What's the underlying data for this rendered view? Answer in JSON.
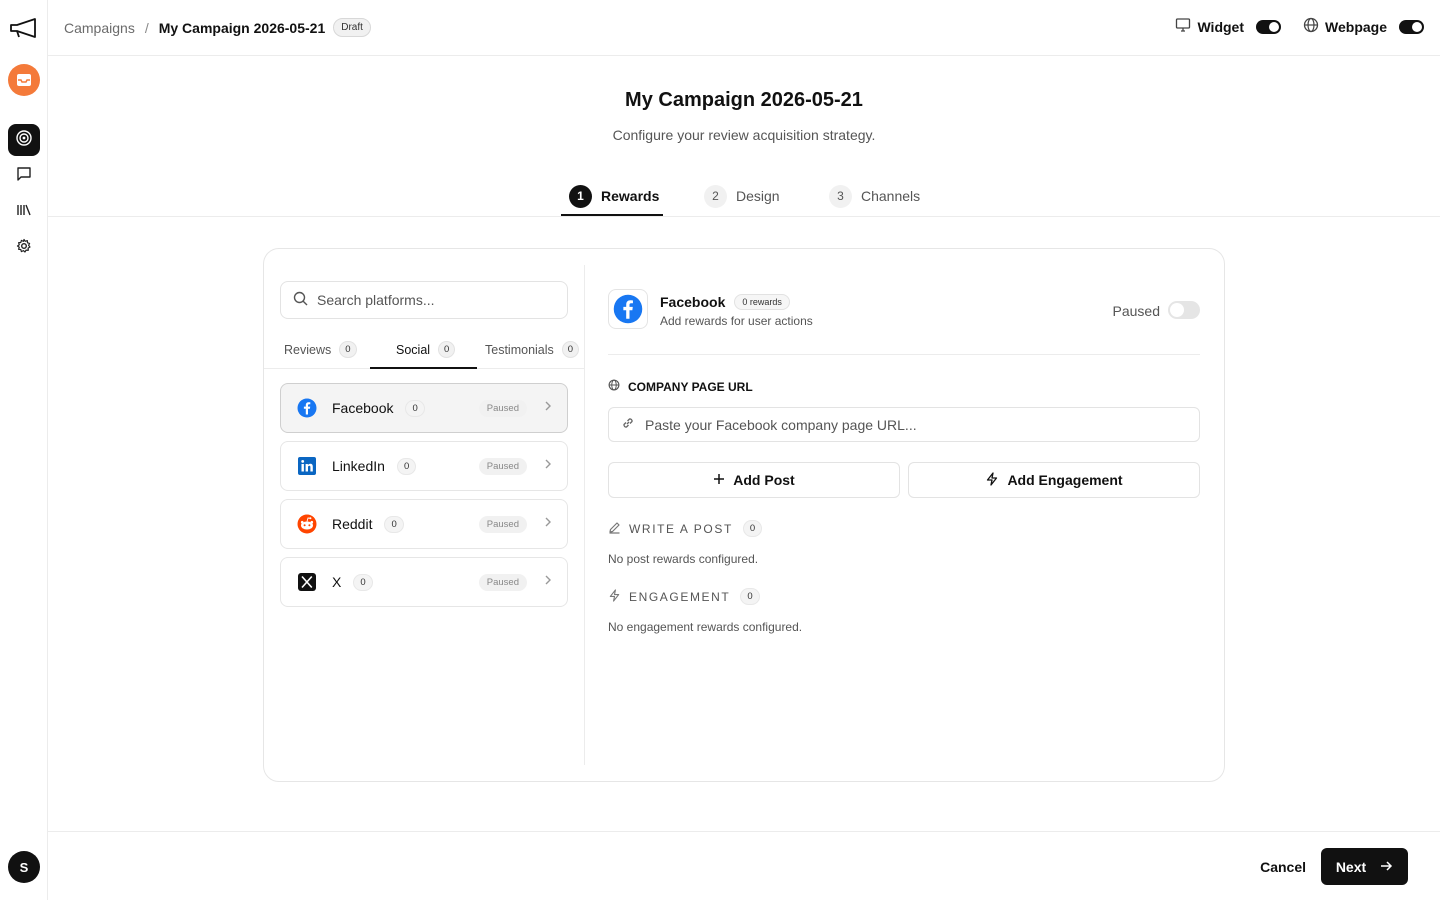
{
  "sidebar": {
    "logo_icon": "megaphone-icon",
    "app_icon": "inbox-icon",
    "items": [
      {
        "icon": "target-icon",
        "active": true
      },
      {
        "icon": "message-icon",
        "active": false
      },
      {
        "icon": "library-icon",
        "active": false
      },
      {
        "icon": "gear-icon",
        "active": false
      }
    ],
    "avatar_initial": "S"
  },
  "topbar": {
    "breadcrumb_root": "Campaigns",
    "breadcrumb_sep": "/",
    "breadcrumb_current": "My Campaign 2026-05-21",
    "status_badge": "Draft",
    "widget_label": "Widget",
    "webpage_label": "Webpage"
  },
  "header": {
    "title": "My Campaign 2026-05-21",
    "subtitle": "Configure your review acquisition strategy."
  },
  "stepper": {
    "steps": [
      {
        "num": "1",
        "label": "Rewards",
        "active": true
      },
      {
        "num": "2",
        "label": "Design",
        "active": false
      },
      {
        "num": "3",
        "label": "Channels",
        "active": false
      }
    ]
  },
  "left": {
    "search_placeholder": "Search platforms...",
    "tabs": [
      {
        "label": "Reviews",
        "count": "0",
        "active": false
      },
      {
        "label": "Social",
        "count": "0",
        "active": true
      },
      {
        "label": "Testimonials",
        "count": "0",
        "active": false
      }
    ],
    "platforms": [
      {
        "name": "Facebook",
        "count": "0",
        "status": "Paused",
        "selected": true
      },
      {
        "name": "LinkedIn",
        "count": "0",
        "status": "Paused",
        "selected": false
      },
      {
        "name": "Reddit",
        "count": "0",
        "status": "Paused",
        "selected": false
      },
      {
        "name": "X",
        "count": "0",
        "status": "Paused",
        "selected": false
      }
    ]
  },
  "detail": {
    "platform_name": "Facebook",
    "rewards_badge": "0 rewards",
    "description": "Add rewards for user actions",
    "status_label": "Paused",
    "url_section_title": "COMPANY PAGE URL",
    "url_placeholder": "Paste your Facebook company page URL...",
    "add_post_label": "Add Post",
    "add_engagement_label": "Add Engagement",
    "write_post_label": "WRITE A POST",
    "write_post_count": "0",
    "write_post_empty": "No post rewards configured.",
    "engagement_label": "ENGAGEMENT",
    "engagement_count": "0",
    "engagement_empty": "No engagement rewards configured."
  },
  "footer": {
    "cancel_label": "Cancel",
    "next_label": "Next"
  },
  "colors": {
    "accent": "#111111",
    "app_orange": "#f47a3a",
    "facebook_blue": "#1877f2",
    "linkedin_blue": "#0a66c2",
    "reddit_orange": "#ff4500"
  }
}
